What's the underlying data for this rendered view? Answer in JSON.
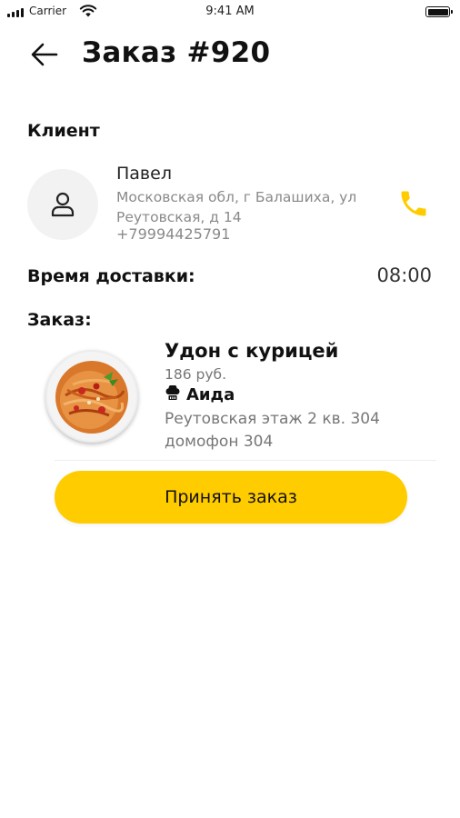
{
  "status_bar": {
    "carrier": "Carrier",
    "time": "9:41 AM",
    "battery_level_percent": 100
  },
  "header": {
    "back_icon": "arrow-left-icon",
    "title": "Заказ #920"
  },
  "client": {
    "section_label": "Клиент",
    "avatar_icon": "user-icon",
    "name": "Павел",
    "address": "Московская обл, г Балашиха, ул Реутовская, д 14",
    "phone": "+79994425791",
    "phone_icon": "phone-icon"
  },
  "delivery": {
    "label": "Время доставки:",
    "time": "08:00"
  },
  "order": {
    "section_label": "Заказ:",
    "items": [
      {
        "name": "Удон с курицей",
        "price": "186 руб.",
        "restaurant_icon": "chef-hat-icon",
        "restaurant": "Аида",
        "address": "Реутовская  этаж 2  кв. 304  домофон 304"
      }
    ]
  },
  "actions": {
    "accept_label": "Принять заказ"
  },
  "colors": {
    "accent": "#ffcc00",
    "muted_text": "#8a8a8a",
    "avatar_bg": "#f2f2f2"
  }
}
